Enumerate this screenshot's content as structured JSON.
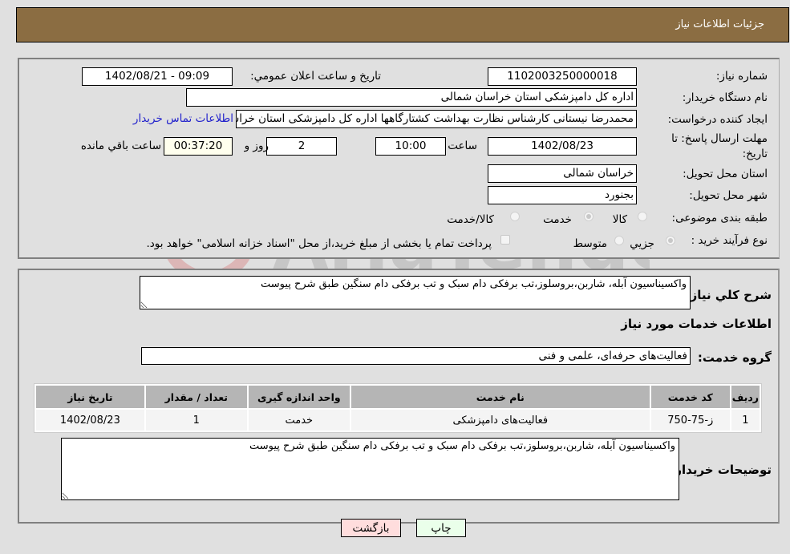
{
  "header": {
    "title": "جزئیات اطلاعات نیاز"
  },
  "fields": {
    "need_number_label": "شماره نیاز:",
    "need_number": "1102003250000018",
    "announce_label": "تاریخ و ساعت اعلان عمومي:",
    "announce_value": "1402/08/21 - 09:09",
    "buyer_org_label": "نام دستگاه خریدار:",
    "buyer_org": "اداره کل دامپزشکی استان خراسان شمالی",
    "creator_label": "ایجاد کننده درخواست:",
    "creator": "محمدرضا نیستانی کارشناس نظارت بهداشت کشتارگاهها اداره کل دامپزشکی استان خراسان شمالی",
    "contact_link": "اطلاعات تماس خریدار",
    "deadline_label": "مهلت ارسال پاسخ: تا تاریخ:",
    "deadline_date": "1402/08/23",
    "time_label": "ساعت",
    "deadline_time": "10:00",
    "days": "2",
    "days_label": "روز و",
    "remaining": "00:37:20",
    "remaining_label": "ساعت باقي مانده",
    "province_label": "استان محل تحویل:",
    "province": "خراسان شمالی",
    "city_label": "شهر محل تحویل:",
    "city": "بجنورد",
    "category_label": "طبقه بندی موضوعی:",
    "category_options": [
      "کالا",
      "خدمت",
      "کالا/خدمت"
    ],
    "category_selected": "خدمت",
    "process_label": "نوع فرآیند خرید :",
    "process_options": [
      "جزيي",
      "متوسط"
    ],
    "process_selected": "جزيي",
    "treasury_note": "پرداخت تمام یا بخشی از مبلغ خرید،از محل \"اسناد خزانه اسلامی\" خواهد بود."
  },
  "details": {
    "summary_label": "شرح کلي نیاز:",
    "summary": "واکسیناسیون آبله، شاربن،بروسلوز،تب برفکی دام سبک و تب برفکی دام سنگین طبق شرح پیوست",
    "services_heading": "اطلاعات خدمات مورد نیاز",
    "service_group_label": "گروه خدمت:",
    "service_group": "فعالیت‌های حرفه‌ای، علمی و فنی",
    "table": {
      "headers": [
        "ردیف",
        "کد خدمت",
        "نام خدمت",
        "واحد اندازه گیری",
        "تعداد / مقدار",
        "تاریخ نیاز"
      ],
      "rows": [
        [
          "1",
          "ز-75-750",
          "فعالیت‌های دامپزشکی",
          "خدمت",
          "1",
          "1402/08/23"
        ]
      ]
    },
    "buyer_notes_label": "توضیحات خریدار:",
    "buyer_notes": "واکسیناسیون آبله، شاربن،بروسلوز،تب برفکی دام سبک و تب برفکی دام سنگین طبق شرح پیوست"
  },
  "buttons": {
    "print": "چاپ",
    "back": "بازگشت"
  },
  "colors": {
    "header_bg": "#8b6d42",
    "print_bg": "#eaffea",
    "back_bg": "#ffdddd",
    "link": "#2222cc"
  }
}
